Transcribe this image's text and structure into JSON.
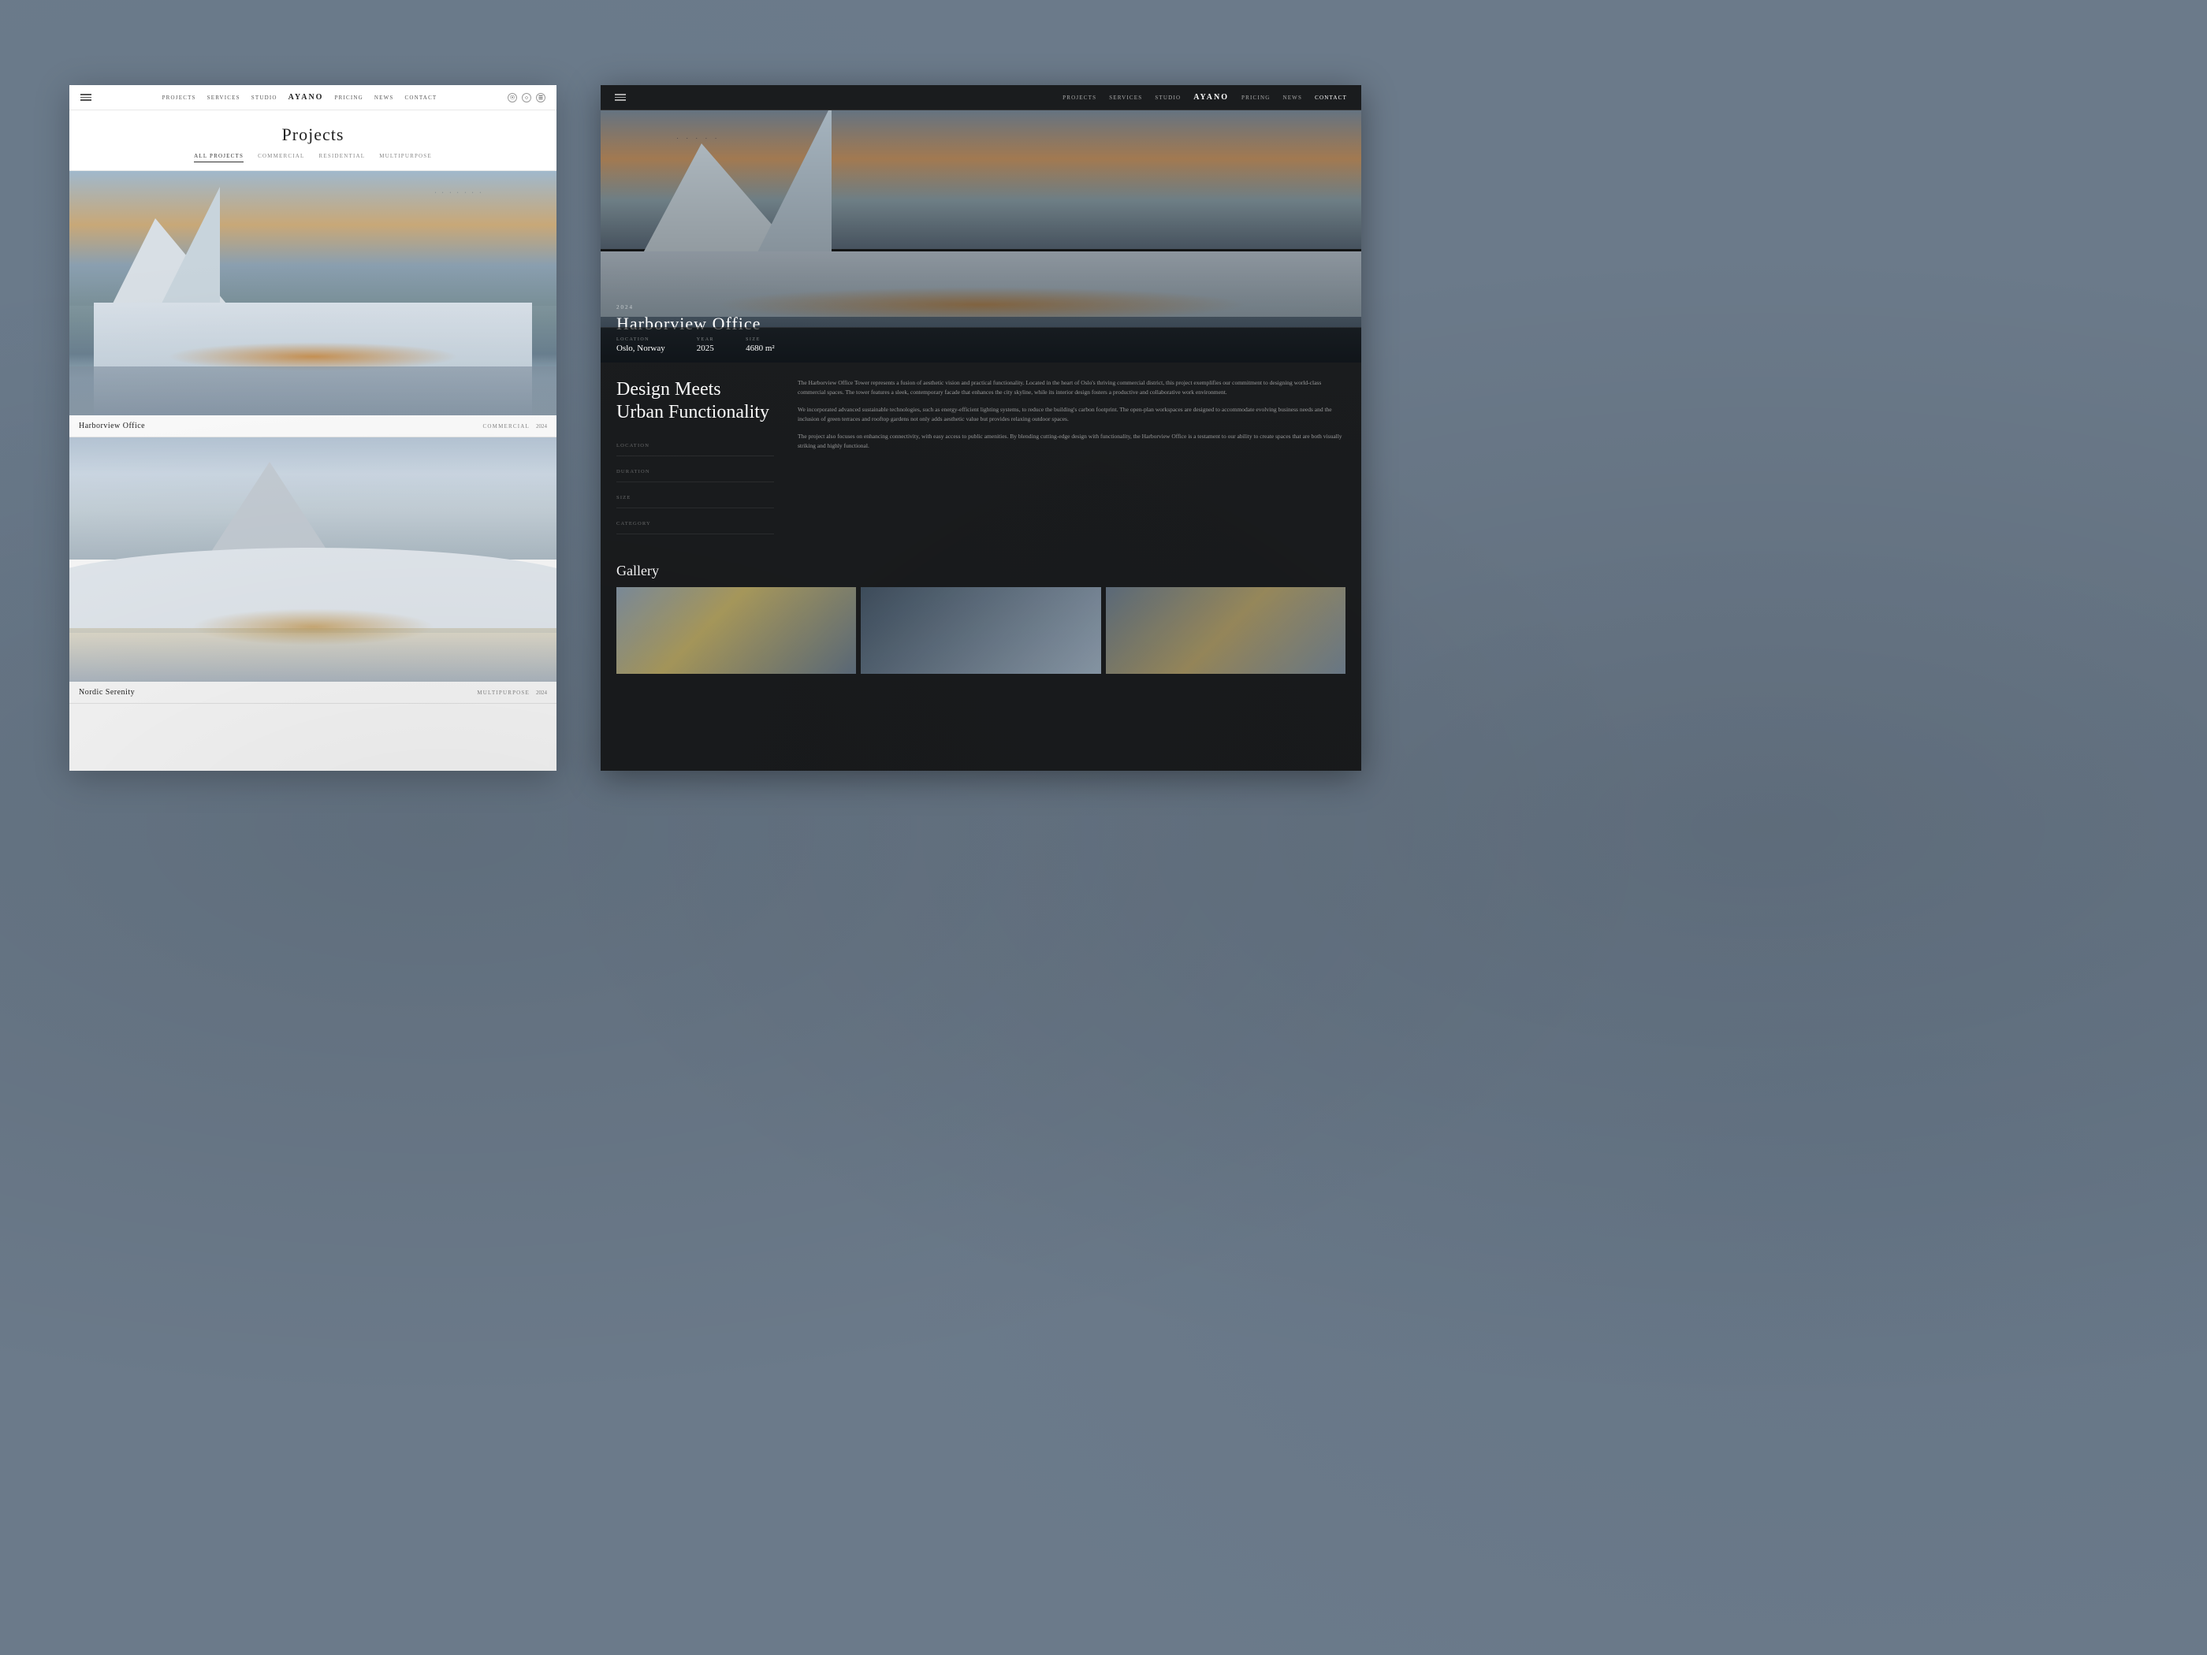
{
  "site": {
    "logo": "AYANO",
    "nav_links": [
      "PROJECTS",
      "SERVICES",
      "STUDIO",
      "PRICING",
      "NEWS",
      "CONTACT"
    ]
  },
  "left_panel": {
    "title": "Projects",
    "filters": [
      {
        "label": "ALL PROJECTS",
        "active": true
      },
      {
        "label": "COMMERCIAL",
        "active": false
      },
      {
        "label": "RESIDENTIAL",
        "active": false
      },
      {
        "label": "MULTIPURPOSE",
        "active": false
      }
    ],
    "projects": [
      {
        "name": "Harborview Office",
        "tag": "COMMERCIAL",
        "year": "2024"
      },
      {
        "name": "Nordic Serenity",
        "tag": "MULTIPURPOSE",
        "year": "2024"
      }
    ]
  },
  "right_panel": {
    "hero_subtitle": "2024",
    "hero_title": "Harborview Office",
    "stats": [
      {
        "label": "LOCATION",
        "value": "Oslo, Norway"
      },
      {
        "label": "YEAR",
        "value": "2025"
      },
      {
        "label": "SIZE",
        "value": "4680 m²"
      }
    ],
    "heading_line1": "Design Meets",
    "heading_line2": "Urban Functionality",
    "paragraphs": [
      "The Harborview Office Tower represents a fusion of aesthetic vision and practical functionality. Located in the heart of Oslo's thriving commercial district, this project exemplifies our commitment to designing world-class commercial spaces. The tower features a sleek, contemporary facade that enhances the city skyline, while its interior design fosters a productive and collaborative work environment.",
      "We incorporated advanced sustainable technologies, such as energy-efficient lighting systems, to reduce the building's carbon footprint. The open-plan workspaces are designed to accommodate evolving business needs and the inclusion of green terraces and rooftop gardens not only adds aesthetic value but provides relaxing outdoor spaces.",
      "The project also focuses on enhancing connectivity, with easy access to public amenities. By blending cutting-edge design with functionality, the Harborview Office is a testament to our ability to create spaces that are both visually striking and highly functional."
    ],
    "details": [
      {
        "key": "Location"
      },
      {
        "key": "Duration"
      },
      {
        "key": "Size"
      },
      {
        "key": "Category"
      }
    ],
    "gallery_title": "Gallery"
  }
}
